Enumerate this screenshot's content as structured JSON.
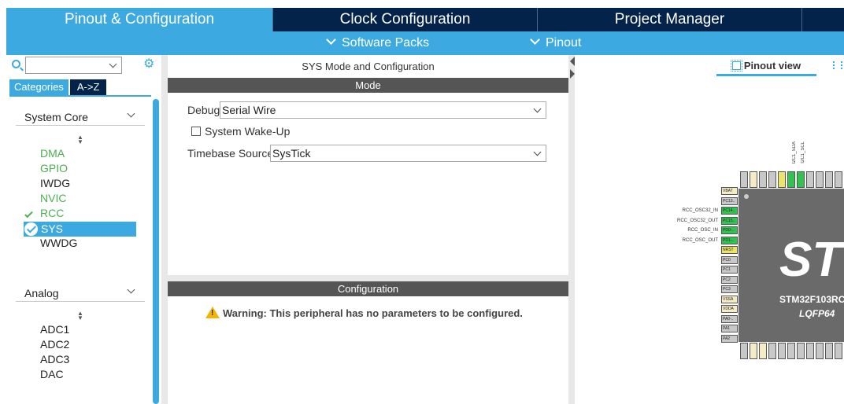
{
  "tabs": [
    {
      "label": "Pinout & Configuration",
      "active": true
    },
    {
      "label": "Clock Configuration",
      "active": false
    },
    {
      "label": "Project Manager",
      "active": false
    }
  ],
  "subnav": {
    "software_packs": "Software Packs",
    "pinout": "Pinout"
  },
  "left": {
    "search_value": "",
    "category_tabs": [
      "Categories",
      "A->Z"
    ],
    "groups": [
      {
        "label": "System Core",
        "items": [
          {
            "label": "DMA",
            "state": "green"
          },
          {
            "label": "GPIO",
            "state": "green"
          },
          {
            "label": "IWDG",
            "state": "normal"
          },
          {
            "label": "NVIC",
            "state": "green"
          },
          {
            "label": "RCC",
            "state": "checked"
          },
          {
            "label": "SYS",
            "state": "selected"
          },
          {
            "label": "WWDG",
            "state": "normal"
          }
        ]
      },
      {
        "label": "Analog",
        "items": [
          {
            "label": "ADC1",
            "state": "normal"
          },
          {
            "label": "ADC2",
            "state": "normal"
          },
          {
            "label": "ADC3",
            "state": "normal"
          },
          {
            "label": "DAC",
            "state": "normal"
          }
        ]
      }
    ]
  },
  "mid": {
    "title": "SYS Mode and Configuration",
    "mode_header": "Mode",
    "debug_label": "Debug",
    "debug_value": "Serial Wire",
    "wakeup_label": "System Wake-Up",
    "timebase_label": "Timebase Source",
    "timebase_value": "SysTick",
    "config_header": "Configuration",
    "warning": "Warning: This peripheral has no parameters to be configured."
  },
  "right": {
    "pinout_view_label": "Pinout view",
    "chip_name": "STM32F103RC",
    "chip_package": "LQFP64",
    "left_pins": [
      "VBAT",
      "PC13..",
      "PC14..",
      "PC15..",
      "PD0-..",
      "PD1-..",
      "NRST",
      "PC0",
      "PC1",
      "PC2",
      "PC3",
      "VSSA",
      "VDDA",
      "PA0-..",
      "PA1",
      "PA2"
    ],
    "left_signals": [
      "RCC_OSC32_IN",
      "RCC_OSC32_OUT",
      "RCC_OSC_IN",
      "RCC_OSC_OUT"
    ],
    "top_signals": [
      "I2C1_SDA",
      "I2C1_SCL"
    ],
    "colors": {
      "green": "#31c24f",
      "yellow": "#ece36a",
      "beige": "#f5ebc4",
      "grey": "#c8c8c8"
    }
  },
  "colors": {
    "accent": "#3caae0",
    "navy": "#03234b",
    "section": "#555555"
  }
}
